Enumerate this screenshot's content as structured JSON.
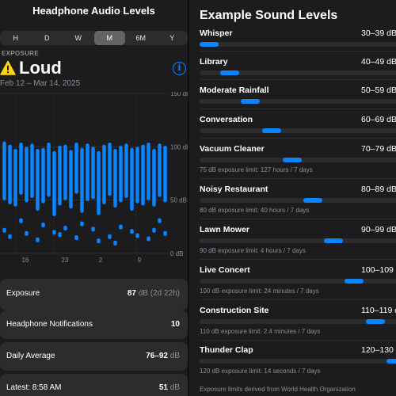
{
  "left": {
    "title": "Headphone Audio Levels",
    "ranges": [
      "H",
      "D",
      "W",
      "M",
      "6M",
      "Y"
    ],
    "selected_range": "M",
    "section_label": "EXPOSURE",
    "status": "Loud",
    "warning_icon": "warning-triangle-icon",
    "info_icon_glyph": "i",
    "date_range": "Feb 12 – Mar 14, 2025",
    "stats": [
      {
        "label": "Exposure",
        "value": "87",
        "unit": " dB (2d 22h)"
      },
      {
        "label": "Headphone Notifications",
        "value": "10",
        "unit": ""
      },
      {
        "label": "Daily Average",
        "value": "76–92",
        "unit": " dB"
      },
      {
        "label": "Latest: 8:58 AM",
        "value": "51",
        "unit": " dB"
      }
    ]
  },
  "chart_data": {
    "type": "bar",
    "y_ticks": [
      "150 dB",
      "100 dB",
      "50 dB",
      "0 dB"
    ],
    "x_ticks": [
      "16",
      "23",
      "2",
      "9"
    ],
    "ylim": [
      0,
      150
    ],
    "series": [
      {
        "values": [
          [
            50,
            105
          ],
          [
            46,
            102
          ],
          [
            44,
            98
          ],
          [
            55,
            104
          ],
          [
            48,
            100
          ],
          [
            52,
            103
          ],
          [
            40,
            98
          ],
          [
            47,
            99
          ],
          [
            53,
            104
          ],
          [
            35,
            96
          ],
          [
            45,
            101
          ],
          [
            50,
            102
          ],
          [
            42,
            97
          ],
          [
            56,
            104
          ],
          [
            38,
            99
          ],
          [
            49,
            103
          ],
          [
            51,
            100
          ],
          [
            36,
            96
          ],
          [
            46,
            102
          ],
          [
            54,
            104
          ],
          [
            43,
            98
          ],
          [
            48,
            101
          ],
          [
            52,
            103
          ],
          [
            40,
            99
          ],
          [
            47,
            100
          ],
          [
            45,
            102
          ],
          [
            50,
            104
          ],
          [
            44,
            98
          ],
          [
            53,
            103
          ],
          [
            48,
            101
          ]
        ]
      }
    ],
    "dots": [
      [
        0,
        21
      ],
      [
        1,
        15
      ],
      [
        3,
        30
      ],
      [
        4,
        18
      ],
      [
        6,
        12
      ],
      [
        7,
        26
      ],
      [
        9,
        19
      ],
      [
        10,
        17
      ],
      [
        11,
        23
      ],
      [
        13,
        14
      ],
      [
        14,
        27
      ],
      [
        16,
        22
      ],
      [
        17,
        11
      ],
      [
        19,
        15
      ],
      [
        20,
        9
      ],
      [
        21,
        24
      ],
      [
        23,
        20
      ],
      [
        24,
        16
      ],
      [
        26,
        13
      ],
      [
        27,
        21
      ],
      [
        28,
        30
      ],
      [
        29,
        18
      ]
    ],
    "color": "#0a84ff"
  },
  "right": {
    "title": "Example Sound Levels",
    "accent": "#0a84ff",
    "levels": [
      {
        "name": "Whisper",
        "range": "30–39 dB",
        "fill": 0.0,
        "limit": ""
      },
      {
        "name": "Library",
        "range": "40–49 dB",
        "fill": 0.1,
        "limit": ""
      },
      {
        "name": "Moderate Rainfall",
        "range": "50–59 dB",
        "fill": 0.2,
        "limit": ""
      },
      {
        "name": "Conversation",
        "range": "60–69 dB",
        "fill": 0.3,
        "limit": ""
      },
      {
        "name": "Vacuum Cleaner",
        "range": "70–79 dB",
        "fill": 0.4,
        "limit": "75 dB exposure limit: 127 hours / 7 days"
      },
      {
        "name": "Noisy Restaurant",
        "range": "80–89 dB",
        "fill": 0.5,
        "limit": "80 dB exposure limit: 40 hours / 7 days"
      },
      {
        "name": "Lawn Mower",
        "range": "90–99 dB",
        "fill": 0.6,
        "limit": "90 dB exposure limit: 4 hours / 7 days"
      },
      {
        "name": "Live Concert",
        "range": "100–109 dB",
        "fill": 0.7,
        "limit": "100 dB exposure limit: 24 minutes / 7 days"
      },
      {
        "name": "Construction Site",
        "range": "110–119 dB",
        "fill": 0.8,
        "limit": "110 dB exposure limit: 2.4 minutes / 7 days"
      },
      {
        "name": "Thunder Clap",
        "range": "120–130 dB",
        "fill": 0.9,
        "limit": "120 dB exposure limit: 14 seconds / 7 days"
      }
    ],
    "footer": "Exposure limits derived from World Health Organization"
  }
}
